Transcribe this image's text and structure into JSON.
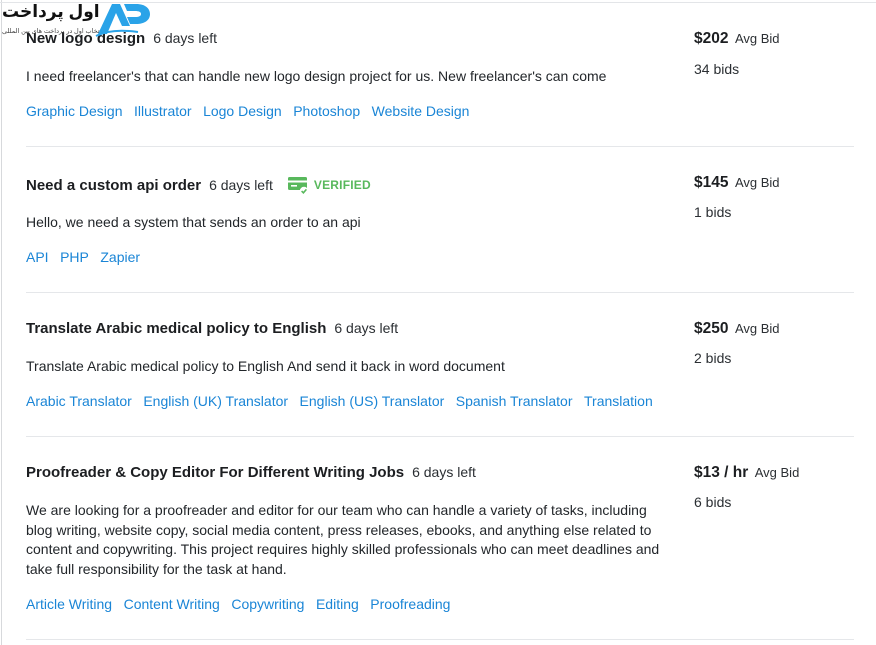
{
  "logo": {
    "brand_text": "اول پرداخت",
    "brand_sub": "انتخاب اول در پرداخت های بین المللی",
    "mark_color": "#2aa3e8"
  },
  "colors": {
    "tag_link": "#1a85d6",
    "verified": "#58b85c",
    "divider": "#e5e7ea"
  },
  "projects": [
    {
      "title": "New logo design",
      "time_left": "6 days left",
      "verified": false,
      "description": "I need freelancer's that can handle new logo design project for us. New freelancer's can come",
      "tags": [
        "Graphic Design",
        "Illustrator",
        "Logo Design",
        "Photoshop",
        "Website Design"
      ],
      "bid_amount": "$202",
      "bid_label": "Avg Bid",
      "bids_count": "34 bids"
    },
    {
      "title": "Need a custom api order",
      "time_left": "6 days left",
      "verified": true,
      "verified_label": "VERIFIED",
      "description": "Hello, we need a system that sends an order to an api",
      "tags": [
        "API",
        "PHP",
        "Zapier"
      ],
      "bid_amount": "$145",
      "bid_label": "Avg Bid",
      "bids_count": "1 bids"
    },
    {
      "title": "Translate Arabic medical policy to English",
      "time_left": "6 days left",
      "verified": false,
      "description": "Translate Arabic medical policy to English And send it back in word document",
      "tags": [
        "Arabic Translator",
        "English (UK) Translator",
        "English (US) Translator",
        "Spanish Translator",
        "Translation"
      ],
      "bid_amount": "$250",
      "bid_label": "Avg Bid",
      "bids_count": "2 bids"
    },
    {
      "title": "Proofreader & Copy Editor For Different Writing Jobs",
      "time_left": "6 days left",
      "verified": false,
      "description": "We are looking for a proofreader and editor for our team who can handle a variety of tasks, including blog writing, website copy, social media content, press releases, ebooks, and anything else related to content and copywriting. This project requires highly skilled professionals who can meet deadlines and take full responsibility for the task at hand.",
      "tags": [
        "Article Writing",
        "Content Writing",
        "Copywriting",
        "Editing",
        "Proofreading"
      ],
      "bid_amount": "$13 / hr",
      "bid_label": "Avg Bid",
      "bids_count": "6 bids"
    }
  ]
}
